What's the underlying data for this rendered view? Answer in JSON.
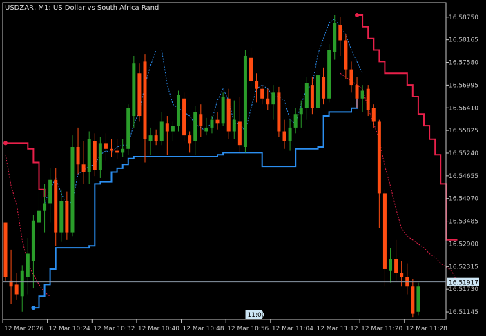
{
  "window": {
    "title": "USDZAR, M1:  US Dollar vs South Africa Rand"
  },
  "colors": {
    "background": "#000000",
    "axis": "#c8c8c8",
    "bull": "#2a9d2a",
    "bear": "#ff4d12",
    "support_line": "#2b8ef0",
    "resistance_line": "#e8204a",
    "current_price_line": "#8a97a6",
    "marker_bg": "#cde6f5"
  },
  "chart_data": {
    "type": "candlestick",
    "symbol": "USDZAR",
    "timeframe": "M1",
    "ylim": [
      16.5095,
      16.5912
    ],
    "y_ticks": [
      "16.58750",
      "16.58165",
      "16.57580",
      "16.56995",
      "16.56410",
      "16.55825",
      "16.55240",
      "16.54655",
      "16.54070",
      "16.53485",
      "16.52900",
      "16.52315",
      "16.51730",
      "16.51145"
    ],
    "x_ticks": [
      {
        "label": "12 Mar 2026",
        "bar": 0
      },
      {
        "label": "12 Mar 10:24",
        "bar": 8
      },
      {
        "label": "12 Mar 10:32",
        "bar": 16
      },
      {
        "label": "12 Mar 10:40",
        "bar": 24
      },
      {
        "label": "12 Mar 10:48",
        "bar": 32
      },
      {
        "label": "12 Mar 10:56",
        "bar": 40
      },
      {
        "label": "12 Mar 11:04",
        "bar": 48
      },
      {
        "label": "12 Mar 11:12",
        "bar": 56
      },
      {
        "label": "12 Mar 11:20",
        "bar": 64
      },
      {
        "label": "12 Mar 11:28",
        "bar": 72
      }
    ],
    "current_price": "16.51917",
    "time_marker": {
      "label": "11:00",
      "bar": 44
    },
    "candles": [
      [
        16.5345,
        16.5345,
        16.5195,
        16.5205
      ],
      [
        16.5195,
        16.5275,
        16.5135,
        16.518
      ],
      [
        16.5185,
        16.5215,
        16.5145,
        16.516
      ],
      [
        16.5155,
        16.5235,
        16.5115,
        16.522
      ],
      [
        16.5205,
        16.5305,
        16.516,
        16.5265
      ],
      [
        16.5245,
        16.5365,
        16.5175,
        16.535
      ],
      [
        16.5345,
        16.5425,
        16.529,
        16.5375
      ],
      [
        16.5375,
        16.5445,
        16.532,
        16.5395
      ],
      [
        16.5395,
        16.5485,
        16.5345,
        16.5455
      ],
      [
        16.5455,
        16.5485,
        16.5285,
        16.532
      ],
      [
        16.532,
        16.543,
        16.5295,
        16.54
      ],
      [
        16.54,
        16.5425,
        16.53,
        16.532
      ],
      [
        16.532,
        16.557,
        16.531,
        16.554
      ],
      [
        16.554,
        16.559,
        16.547,
        16.5495
      ],
      [
        16.5495,
        16.5555,
        16.5445,
        16.5475
      ],
      [
        16.5475,
        16.558,
        16.5445,
        16.556
      ],
      [
        16.5555,
        16.5575,
        16.5465,
        16.548
      ],
      [
        16.548,
        16.5565,
        16.546,
        16.555
      ],
      [
        16.555,
        16.5575,
        16.5505,
        16.5535
      ],
      [
        16.5535,
        16.556,
        16.5515,
        16.553
      ],
      [
        16.553,
        16.556,
        16.551,
        16.5525
      ],
      [
        16.5525,
        16.556,
        16.5515,
        16.5535
      ],
      [
        16.5535,
        16.565,
        16.552,
        16.564
      ],
      [
        16.562,
        16.5775,
        16.559,
        16.5755
      ],
      [
        16.573,
        16.5755,
        16.5605,
        16.562
      ],
      [
        16.576,
        16.578,
        16.55,
        16.556
      ],
      [
        16.5555,
        16.559,
        16.552,
        16.557
      ],
      [
        16.557,
        16.5585,
        16.5545,
        16.5555
      ],
      [
        16.5555,
        16.563,
        16.5545,
        16.5605
      ],
      [
        16.56,
        16.562,
        16.552,
        16.558
      ],
      [
        16.558,
        16.5605,
        16.5555,
        16.5595
      ],
      [
        16.5595,
        16.5685,
        16.558,
        16.5675
      ],
      [
        16.5665,
        16.568,
        16.5555,
        16.557
      ],
      [
        16.557,
        16.558,
        16.5525,
        16.555
      ],
      [
        16.5555,
        16.5645,
        16.552,
        16.563
      ],
      [
        16.5625,
        16.565,
        16.5565,
        16.5595
      ],
      [
        16.558,
        16.5615,
        16.557,
        16.559
      ],
      [
        16.559,
        16.562,
        16.5575,
        16.561
      ],
      [
        16.561,
        16.563,
        16.5585,
        16.56
      ],
      [
        16.56,
        16.568,
        16.5595,
        16.567
      ],
      [
        16.5665,
        16.569,
        16.556,
        16.558
      ],
      [
        16.558,
        16.566,
        16.556,
        16.561
      ],
      [
        16.5605,
        16.567,
        16.5525,
        16.5545
      ],
      [
        16.554,
        16.579,
        16.5525,
        16.5775
      ],
      [
        16.577,
        16.5795,
        16.5695,
        16.571
      ],
      [
        16.571,
        16.573,
        16.5655,
        16.569
      ],
      [
        16.569,
        16.57,
        16.565,
        16.5665
      ],
      [
        16.5665,
        16.569,
        16.5635,
        16.565
      ],
      [
        16.565,
        16.57,
        16.561,
        16.568
      ],
      [
        16.568,
        16.5695,
        16.5565,
        16.558
      ],
      [
        16.558,
        16.561,
        16.5535,
        16.5555
      ],
      [
        16.5555,
        16.561,
        16.553,
        16.559
      ],
      [
        16.559,
        16.564,
        16.5575,
        16.5625
      ],
      [
        16.5625,
        16.566,
        16.559,
        16.564
      ],
      [
        16.564,
        16.572,
        16.561,
        16.5705
      ],
      [
        16.57,
        16.572,
        16.5625,
        16.564
      ],
      [
        16.564,
        16.574,
        16.563,
        16.5725
      ],
      [
        16.572,
        16.5745,
        16.565,
        16.5665
      ],
      [
        16.5665,
        16.5805,
        16.5655,
        16.579
      ],
      [
        16.5785,
        16.588,
        16.5765,
        16.586
      ],
      [
        16.5855,
        16.5875,
        16.5775,
        16.5815
      ],
      [
        16.5815,
        16.583,
        16.5715,
        16.574
      ],
      [
        16.574,
        16.576,
        16.568,
        16.57
      ],
      [
        16.57,
        16.572,
        16.564,
        16.5665
      ],
      [
        16.5665,
        16.57,
        16.563,
        16.5685
      ],
      [
        16.569,
        16.57,
        16.562,
        16.5635
      ],
      [
        16.564,
        16.565,
        16.559,
        16.5605
      ],
      [
        16.5605,
        16.561,
        16.533,
        16.542
      ],
      [
        16.542,
        16.543,
        16.518,
        16.5225
      ],
      [
        16.522,
        16.528,
        16.519,
        16.525
      ],
      [
        16.525,
        16.53,
        16.5195,
        16.5215
      ],
      [
        16.5215,
        16.5245,
        16.518,
        16.5205
      ],
      [
        16.5205,
        16.524,
        16.516,
        16.518
      ],
      [
        16.518,
        16.52,
        16.51,
        16.511
      ],
      [
        16.5115,
        16.519,
        16.5105,
        16.518
      ]
    ],
    "support_line": [
      [
        5,
        16.5125
      ],
      [
        6,
        16.5155
      ],
      [
        7,
        16.5185
      ],
      [
        8,
        16.5225
      ],
      [
        9,
        16.528
      ],
      [
        10,
        16.528
      ],
      [
        11,
        16.528
      ],
      [
        12,
        16.528
      ],
      [
        13,
        16.528
      ],
      [
        14,
        16.528
      ],
      [
        15,
        16.5285
      ],
      [
        16,
        16.5445
      ],
      [
        17,
        16.545
      ],
      [
        18,
        16.545
      ],
      [
        19,
        16.5475
      ],
      [
        20,
        16.5485
      ],
      [
        21,
        16.5495
      ],
      [
        22,
        16.551
      ],
      [
        23,
        16.5515
      ],
      [
        24,
        16.5515
      ],
      [
        25,
        16.5515
      ],
      [
        26,
        16.5515
      ],
      [
        27,
        16.5515
      ],
      [
        28,
        16.5515
      ],
      [
        29,
        16.5515
      ],
      [
        30,
        16.5515
      ],
      [
        31,
        16.5515
      ],
      [
        32,
        16.5515
      ],
      [
        33,
        16.5515
      ],
      [
        34,
        16.5515
      ],
      [
        35,
        16.5515
      ],
      [
        36,
        16.5515
      ],
      [
        37,
        16.5515
      ],
      [
        38,
        16.552
      ],
      [
        39,
        16.5525
      ],
      [
        40,
        16.5525
      ],
      [
        41,
        16.5525
      ],
      [
        42,
        16.5525
      ],
      [
        43,
        16.5525
      ],
      [
        44,
        16.5525
      ],
      [
        45,
        16.5525
      ],
      [
        46,
        16.549
      ],
      [
        47,
        16.549
      ],
      [
        48,
        16.549
      ],
      [
        49,
        16.549
      ],
      [
        50,
        16.549
      ],
      [
        51,
        16.549
      ],
      [
        52,
        16.5535
      ],
      [
        53,
        16.5535
      ],
      [
        54,
        16.5535
      ],
      [
        55,
        16.5535
      ],
      [
        56,
        16.554
      ],
      [
        57,
        16.562
      ],
      [
        58,
        16.563
      ],
      [
        59,
        16.563
      ],
      [
        60,
        16.563
      ],
      [
        61,
        16.563
      ],
      [
        62,
        16.564
      ],
      [
        63,
        16.5665
      ]
    ],
    "resistance_line": [
      [
        0,
        16.555
      ],
      [
        1,
        16.555
      ],
      [
        2,
        16.555
      ],
      [
        3,
        16.555
      ],
      [
        4,
        16.5535
      ],
      [
        5,
        16.55
      ],
      [
        6,
        16.543
      ],
      [
        7,
        16.541
      ],
      [
        63,
        16.588
      ],
      [
        64,
        16.585
      ],
      [
        65,
        16.582
      ],
      [
        66,
        16.579
      ],
      [
        67,
        16.576
      ],
      [
        68,
        16.573
      ],
      [
        69,
        16.573
      ],
      [
        70,
        16.573
      ],
      [
        71,
        16.573
      ],
      [
        72,
        16.57
      ],
      [
        73,
        16.567
      ],
      [
        74,
        16.5625
      ],
      [
        75,
        16.5595
      ],
      [
        76,
        16.556
      ],
      [
        77,
        16.552
      ],
      [
        78,
        16.5445
      ],
      [
        79,
        16.53
      ],
      [
        80,
        16.53
      ],
      [
        81,
        16.53
      ]
    ],
    "support_trail": [
      [
        7,
        16.5395
      ],
      [
        8,
        16.543
      ],
      [
        9,
        16.546
      ],
      [
        10,
        16.542
      ],
      [
        11,
        16.539
      ],
      [
        12,
        16.54
      ],
      [
        13,
        16.547
      ],
      [
        14,
        16.548
      ],
      [
        15,
        16.549
      ],
      [
        16,
        16.5495
      ],
      [
        17,
        16.552
      ],
      [
        18,
        16.553
      ],
      [
        19,
        16.5525
      ],
      [
        20,
        16.554
      ],
      [
        21,
        16.5545
      ],
      [
        22,
        16.5545
      ],
      [
        23,
        16.56
      ],
      [
        24,
        16.563
      ],
      [
        25,
        16.57
      ],
      [
        26,
        16.575
      ],
      [
        27,
        16.579
      ],
      [
        28,
        16.579
      ],
      [
        29,
        16.57
      ],
      [
        30,
        16.565
      ],
      [
        31,
        16.564
      ],
      [
        32,
        16.563
      ],
      [
        33,
        16.562
      ],
      [
        34,
        16.56
      ],
      [
        35,
        16.559
      ],
      [
        36,
        16.558
      ],
      [
        37,
        16.561
      ],
      [
        38,
        16.566
      ],
      [
        39,
        16.569
      ],
      [
        40,
        16.566
      ],
      [
        41,
        16.56
      ],
      [
        42,
        16.56
      ],
      [
        43,
        16.558
      ],
      [
        44,
        16.564
      ],
      [
        45,
        16.569
      ],
      [
        46,
        16.57
      ],
      [
        47,
        16.569
      ],
      [
        48,
        16.567
      ],
      [
        49,
        16.567
      ],
      [
        50,
        16.566
      ],
      [
        51,
        16.561
      ],
      [
        52,
        16.56
      ],
      [
        53,
        16.565
      ],
      [
        54,
        16.569
      ],
      [
        55,
        16.57
      ],
      [
        56,
        16.578
      ],
      [
        57,
        16.582
      ],
      [
        58,
        16.586
      ],
      [
        59,
        16.587
      ],
      [
        60,
        16.585
      ],
      [
        61,
        16.583
      ],
      [
        62,
        16.579
      ],
      [
        63,
        16.576
      ],
      [
        64,
        16.573
      ]
    ],
    "resistance_trail": [
      [
        0,
        16.552
      ],
      [
        1,
        16.544
      ],
      [
        2,
        16.539
      ],
      [
        3,
        16.53
      ],
      [
        4,
        16.524
      ],
      [
        5,
        16.521
      ],
      [
        6,
        16.5185
      ],
      [
        7,
        16.5165
      ],
      [
        8,
        16.5155
      ],
      [
        60,
        16.573
      ],
      [
        61,
        16.572
      ],
      [
        62,
        16.571
      ],
      [
        63,
        16.57
      ],
      [
        64,
        16.569
      ],
      [
        65,
        16.564
      ],
      [
        66,
        16.56
      ],
      [
        67,
        16.556
      ],
      [
        68,
        16.549
      ],
      [
        69,
        16.544
      ],
      [
        70,
        16.538
      ],
      [
        71,
        16.533
      ],
      [
        72,
        16.531
      ],
      [
        73,
        16.53
      ],
      [
        74,
        16.529
      ],
      [
        75,
        16.528
      ],
      [
        76,
        16.5265
      ],
      [
        77,
        16.5255
      ],
      [
        78,
        16.524
      ],
      [
        79,
        16.523
      ],
      [
        80,
        16.522
      ],
      [
        81,
        16.519
      ]
    ]
  }
}
